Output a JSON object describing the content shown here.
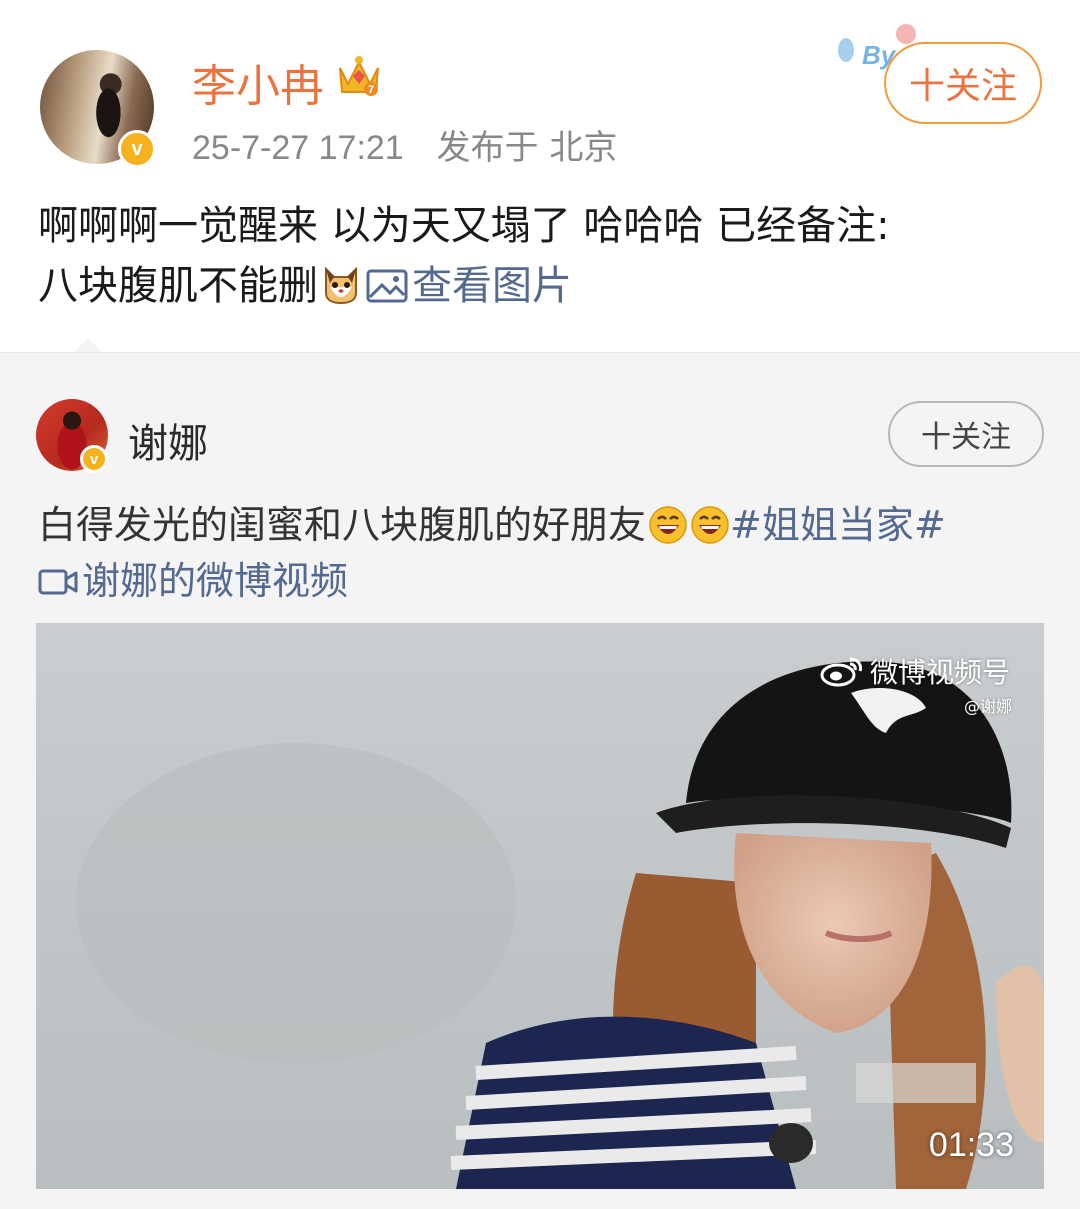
{
  "post": {
    "author": "李小冉",
    "time": "25-7-27 17:21",
    "location": "发布于 北京",
    "follow_label": "十关注",
    "text_line1": "啊啊啊一觉醒来 以为天又塌了 哈哈哈 已经备注:",
    "text_line2": "八块腹肌不能删",
    "view_image_label": "查看图片"
  },
  "repost": {
    "author": "谢娜",
    "follow_label": "十关注",
    "text": "白得发光的闺蜜和八块腹肌的好朋友",
    "hashtag": "#姐姐当家#",
    "video_link": "谢娜的微博视频",
    "video": {
      "watermark": "微博视频号",
      "watermark_sub": "@谢娜",
      "duration": "01:33"
    }
  },
  "colors": {
    "name_orange": "#eb7340",
    "link_blue": "#53698f",
    "verified_gold": "#f5b21c",
    "repost_bg": "#f4f4f4"
  },
  "icons": [
    "crown-icon",
    "verified-badge-icon",
    "cat-emoji-icon",
    "image-icon",
    "laugh-emoji-icon",
    "video-camera-icon",
    "weibo-logo-icon"
  ]
}
